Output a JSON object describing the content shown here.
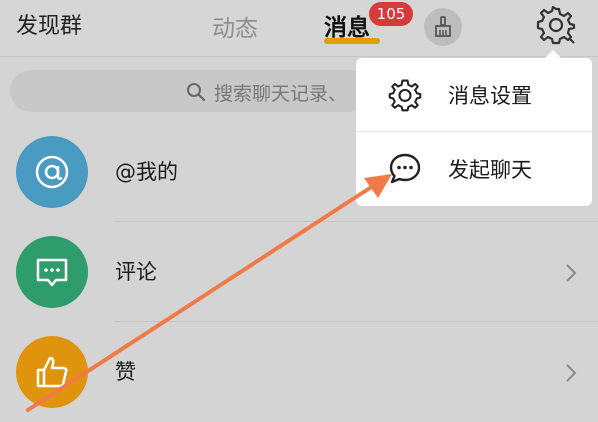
{
  "header": {
    "left_label": "发现群",
    "tabs": [
      {
        "label": "动态",
        "active": false
      },
      {
        "label": "消息",
        "active": true
      }
    ],
    "badge_count": "105",
    "icons": [
      "broom-clean-icon",
      "gear-icon"
    ]
  },
  "search": {
    "placeholder": "搜索聊天记录、",
    "icon": "search-icon"
  },
  "list": {
    "items": [
      {
        "label": "@我的",
        "icon": "at-icon",
        "color": "#4a9bc2"
      },
      {
        "label": "评论",
        "icon": "comment-icon",
        "color": "#2f9d6b"
      },
      {
        "label": "赞",
        "icon": "thumbs-up-icon",
        "color": "#e0940e"
      }
    ]
  },
  "menu": {
    "items": [
      {
        "label": "消息设置",
        "icon": "gear-icon"
      },
      {
        "label": "发起聊天",
        "icon": "chat-bubble-icon"
      }
    ]
  },
  "colors": {
    "accent": "#e1a000",
    "badge": "#d83a3a",
    "annotation_arrow": "#f07a48"
  }
}
